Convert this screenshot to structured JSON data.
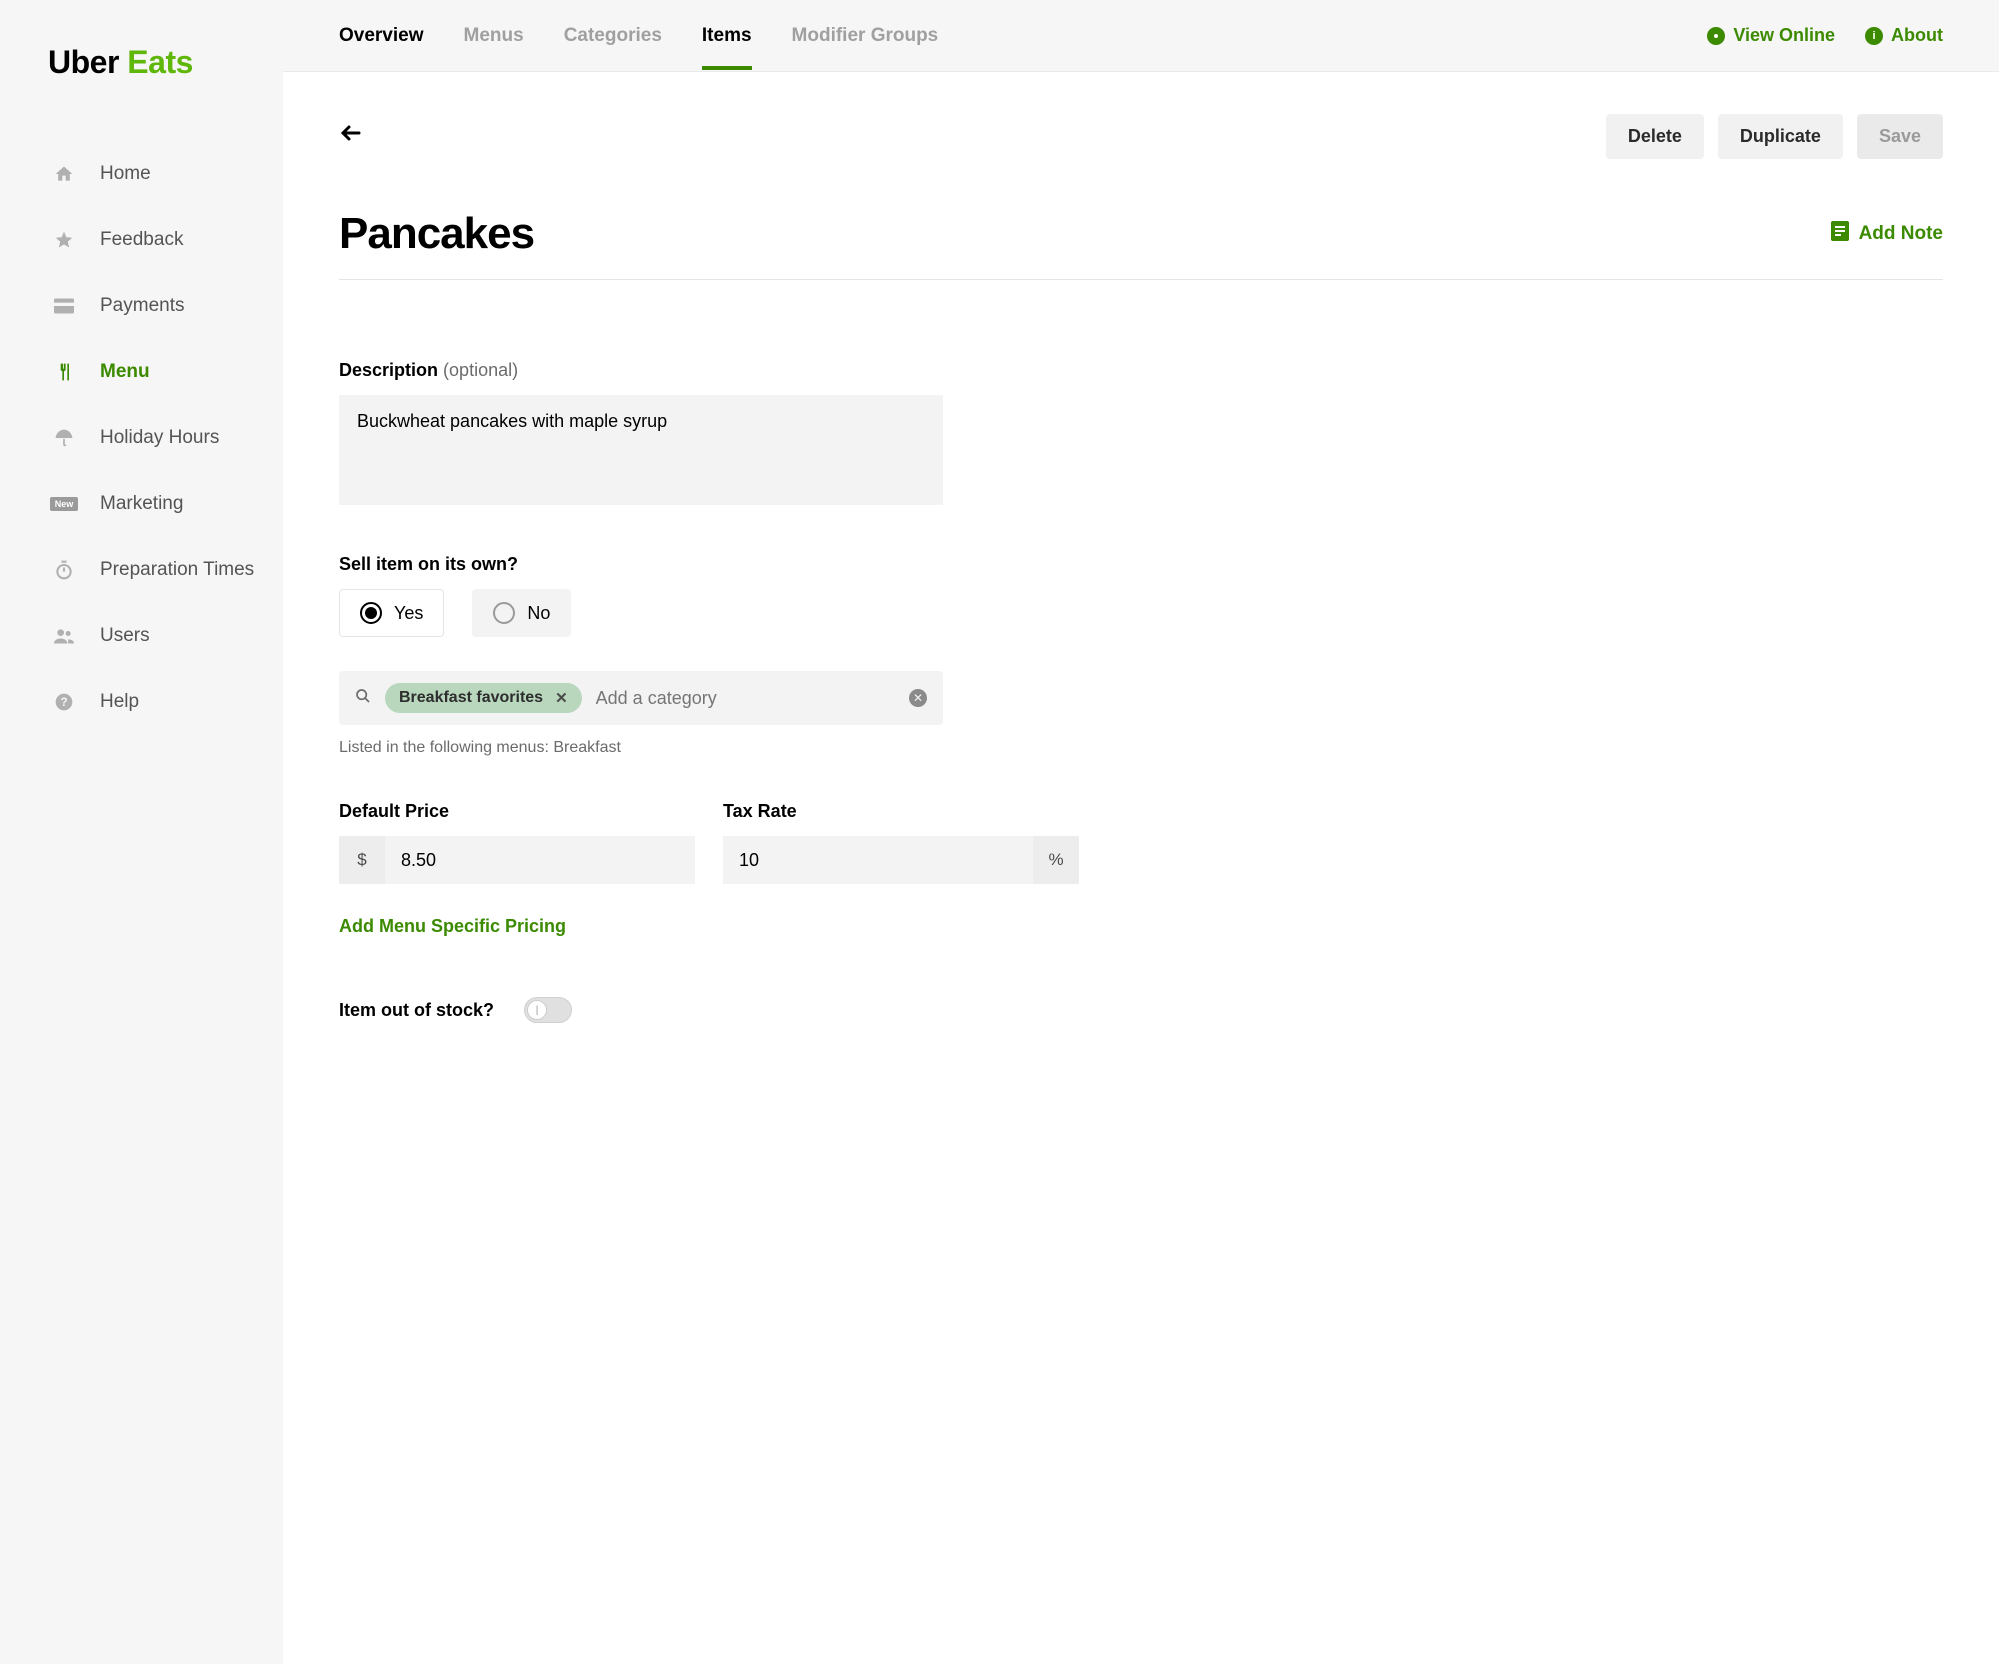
{
  "brand": {
    "part1": "Uber",
    "part2": "Eats"
  },
  "sidebar": {
    "items": [
      {
        "label": "Home",
        "icon": "home-icon"
      },
      {
        "label": "Feedback",
        "icon": "star-icon"
      },
      {
        "label": "Payments",
        "icon": "card-icon"
      },
      {
        "label": "Menu",
        "icon": "utensils-icon",
        "active": true
      },
      {
        "label": "Holiday Hours",
        "icon": "umbrella-icon"
      },
      {
        "label": "Marketing",
        "icon": "new-badge-icon"
      },
      {
        "label": "Preparation Times",
        "icon": "stopwatch-icon"
      },
      {
        "label": "Users",
        "icon": "users-icon"
      },
      {
        "label": "Help",
        "icon": "help-icon"
      }
    ]
  },
  "tabs": [
    {
      "label": "Overview"
    },
    {
      "label": "Menus"
    },
    {
      "label": "Categories"
    },
    {
      "label": "Items",
      "active": true
    },
    {
      "label": "Modifier Groups"
    }
  ],
  "toplinks": {
    "view_online": "View Online",
    "about": "About"
  },
  "actions": {
    "delete": "Delete",
    "duplicate": "Duplicate",
    "save": "Save"
  },
  "item": {
    "title": "Pancakes",
    "add_note": "Add Note",
    "description_label": "Description",
    "description_optional": "(optional)",
    "description_value": "Buckwheat pancakes with maple syrup",
    "sell_own_label": "Sell item on its own?",
    "yes": "Yes",
    "no": "No",
    "sell_own_value": "Yes",
    "category_chip": "Breakfast favorites",
    "category_placeholder": "Add a category",
    "listed_menus_text": "Listed in the following menus: Breakfast",
    "default_price_label": "Default Price",
    "default_price_currency": "$",
    "default_price_value": "8.50",
    "tax_rate_label": "Tax Rate",
    "tax_rate_value": "10",
    "tax_rate_suffix": "%",
    "menu_pricing_link": "Add Menu Specific Pricing",
    "out_of_stock_label": "Item out of stock?",
    "out_of_stock_value": false
  }
}
